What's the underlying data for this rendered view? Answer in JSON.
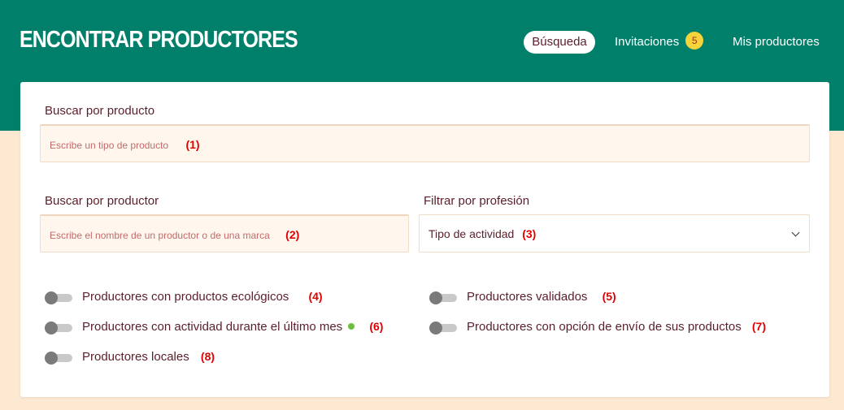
{
  "header": {
    "title": "ENCONTRAR PRODUCTORES",
    "nav": {
      "search": "Búsqueda",
      "invitations": "Invitaciones",
      "invitations_count": "5",
      "my_producers": "Mis productores"
    }
  },
  "search_product": {
    "label": "Buscar por producto",
    "placeholder": "Escribe un tipo de producto",
    "marker": "(1)"
  },
  "search_producer": {
    "label": "Buscar por productor",
    "placeholder": "Escribe el nombre de un productor o de una marca",
    "marker": "(2)"
  },
  "profession_filter": {
    "label": "Filtrar por profesión",
    "selected": "Tipo de actividad",
    "marker": "(3)"
  },
  "toggles": {
    "organic": {
      "label": "Productores con productos ecológicos",
      "marker": "(4)",
      "on": false
    },
    "validated": {
      "label": "Productores validados",
      "marker": "(5)",
      "on": false
    },
    "active_last_month": {
      "label": "Productores con actividad durante el último mes",
      "marker": "(6)",
      "on": false
    },
    "shipping": {
      "label": "Productores con opción de envío de sus productos",
      "marker": "(7)",
      "on": false
    },
    "local": {
      "label": "Productores locales",
      "marker": "(8)",
      "on": false
    }
  },
  "colors": {
    "brand_green": "#00806a",
    "background_peach": "#fde8d1",
    "text_maroon": "#5a1f2b",
    "badge_yellow": "#f5d43b",
    "marker_red": "#e00000",
    "activity_dot": "#6cbf3c"
  }
}
